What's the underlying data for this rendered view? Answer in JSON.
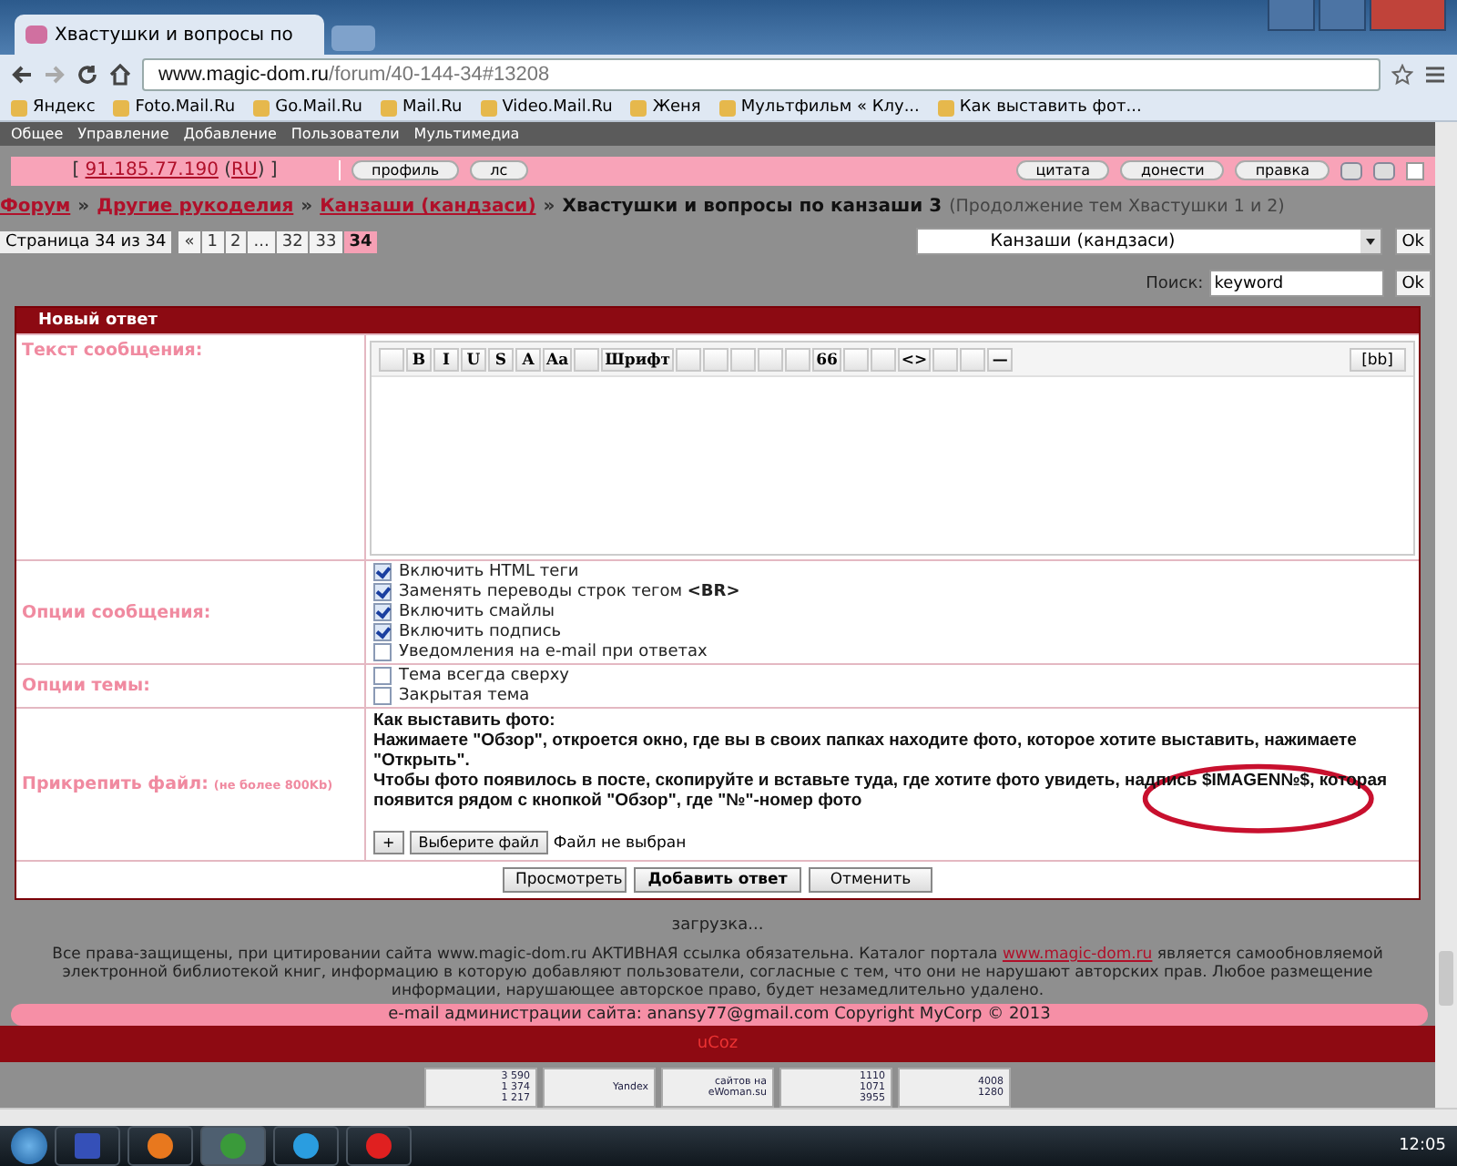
{
  "browser": {
    "tab_title": "Хвастушки и вопросы по",
    "url_host": "www.magic-dom.ru",
    "url_path": "/forum/40-144-34#13208",
    "bookmarks": [
      "Яндекс",
      "Foto.Mail.Ru",
      "Go.Mail.Ru",
      "Mail.Ru",
      "Video.Mail.Ru",
      "Женя",
      "Мультфильм « Клу...",
      "Как выставить фот..."
    ]
  },
  "site_menu": [
    "Общее",
    "Управление",
    "Добавление",
    "Пользователи",
    "Мультимедиа"
  ],
  "post_bar": {
    "open": "[",
    "ip": "91.185.77.190",
    "paren_open": "(",
    "country": "RU",
    "close": ") ]",
    "select_checked": false,
    "left_buttons": [
      "профиль",
      "лс"
    ],
    "right_buttons": [
      "цитата",
      "донести",
      "правка"
    ]
  },
  "breadcrumbs": {
    "separator": "»",
    "links": [
      "Форум",
      "Другие рукоделия",
      "Канзаши (кандзаси)"
    ],
    "current": "Хвастушки и вопросы по канзаши 3",
    "note": "(Продолжение тем Хвастушки 1 и 2)"
  },
  "pagination": {
    "label": "Страница 34 из 34",
    "pages": [
      {
        "label": "«",
        "selected": false
      },
      {
        "label": "1",
        "selected": false
      },
      {
        "label": "2",
        "selected": false
      },
      {
        "label": "...",
        "selected": false
      },
      {
        "label": "32",
        "selected": false
      },
      {
        "label": "33",
        "selected": false
      },
      {
        "label": "34",
        "selected": true
      }
    ]
  },
  "forum_select": {
    "value": "Канзаши (кандзаси)",
    "button": "Ok"
  },
  "search": {
    "label": "Поиск:",
    "value": "keyword",
    "button": "Ok"
  },
  "form": {
    "title": "Новый ответ",
    "message_label": "Текст сообщения:",
    "toolbar": [
      {
        "kind": "icon"
      },
      {
        "kind": "text",
        "label": "B"
      },
      {
        "kind": "text",
        "label": "I"
      },
      {
        "kind": "text",
        "label": "U"
      },
      {
        "kind": "text",
        "label": "S"
      },
      {
        "kind": "text",
        "label": "A"
      },
      {
        "kind": "text",
        "label": "Aa"
      },
      {
        "kind": "icon"
      },
      {
        "kind": "text",
        "label": "Шрифт"
      },
      {
        "kind": "icon"
      },
      {
        "kind": "icon"
      },
      {
        "kind": "icon"
      },
      {
        "kind": "icon"
      },
      {
        "kind": "icon"
      },
      {
        "kind": "text",
        "label": "66"
      },
      {
        "kind": "icon"
      },
      {
        "kind": "icon"
      },
      {
        "kind": "text",
        "label": "<>"
      },
      {
        "kind": "icon"
      },
      {
        "kind": "icon"
      },
      {
        "kind": "text",
        "label": "—"
      }
    ],
    "bb_button": "[bb]",
    "options_label": "Опции сообщения:",
    "options": [
      {
        "label": "Включить HTML теги",
        "checked": true
      },
      {
        "label": "Заменять переводы строк тегом **<BR>**",
        "checked": true
      },
      {
        "label": "Включить смайлы",
        "checked": true
      },
      {
        "label": "Включить подпись",
        "checked": true
      },
      {
        "label": "Уведомления на e-mail при ответах",
        "checked": false
      }
    ],
    "topic_label": "Опции темы:",
    "topic_options": [
      {
        "label": "Тема всегда сверху",
        "checked": false
      },
      {
        "label": "Закрытая тема",
        "checked": false
      }
    ],
    "attach_label": "Прикрепить файл:",
    "attach_hint": "(не более 800Kb)",
    "attach_text": [
      "Как выставить фото:",
      "Нажимаете \"Обзор\", откроется окно, где вы в своих папках находите фото, которое хотите выставить, нажимаете \"Открыть\"."
    ],
    "attach_note": {
      "before": "Чтобы фото появилось в посте, скопируйте и вставьте туда, где хотите фото увидеть, надпись",
      "circled": "$IMAGEN№$,",
      "after": "которая появится рядом с кнопкой \"Обзор\", где \"№\"-номер фото"
    },
    "add_button": "+",
    "file_button": "Выберите файл",
    "file_status": "Файл не выбран",
    "buttons": [
      {
        "label": "Просмотреть",
        "primary": false
      },
      {
        "label": "Добавить ответ",
        "primary": true
      },
      {
        "label": "Отменить",
        "primary": false
      }
    ]
  },
  "loading": "загрузка...",
  "footer": {
    "before": "Все права-защищены, при цитировании сайта www.magic-dom.ru АКТИВНАЯ ссылка обязательна. Каталог портала",
    "link": "www.magic-dom.ru",
    "after": "является самообновляемой электронной библиотекой книг, информацию в которую добавляют пользователи, согласные с тем, что они не нарушают авторских прав. Любое размещение информации, нарушающее авторское право, будет незамедлительно удалено.",
    "email_line": "e-mail администрации сайта: anansy77@gmail.com Copyright MyCorp © 2013",
    "hosting": "uCoz"
  },
  "counters": [
    {
      "lines": [
        "3 590",
        "1 374",
        "1 217"
      ]
    },
    {
      "lines": [
        "Yandex"
      ]
    },
    {
      "lines": [
        "сайтов на",
        "eWoman.su"
      ]
    },
    {
      "lines": [
        "1110",
        "1071",
        "3955"
      ]
    },
    {
      "lines": [
        "4008",
        "1280"
      ]
    }
  ],
  "taskbar": {
    "time": "12:05"
  }
}
